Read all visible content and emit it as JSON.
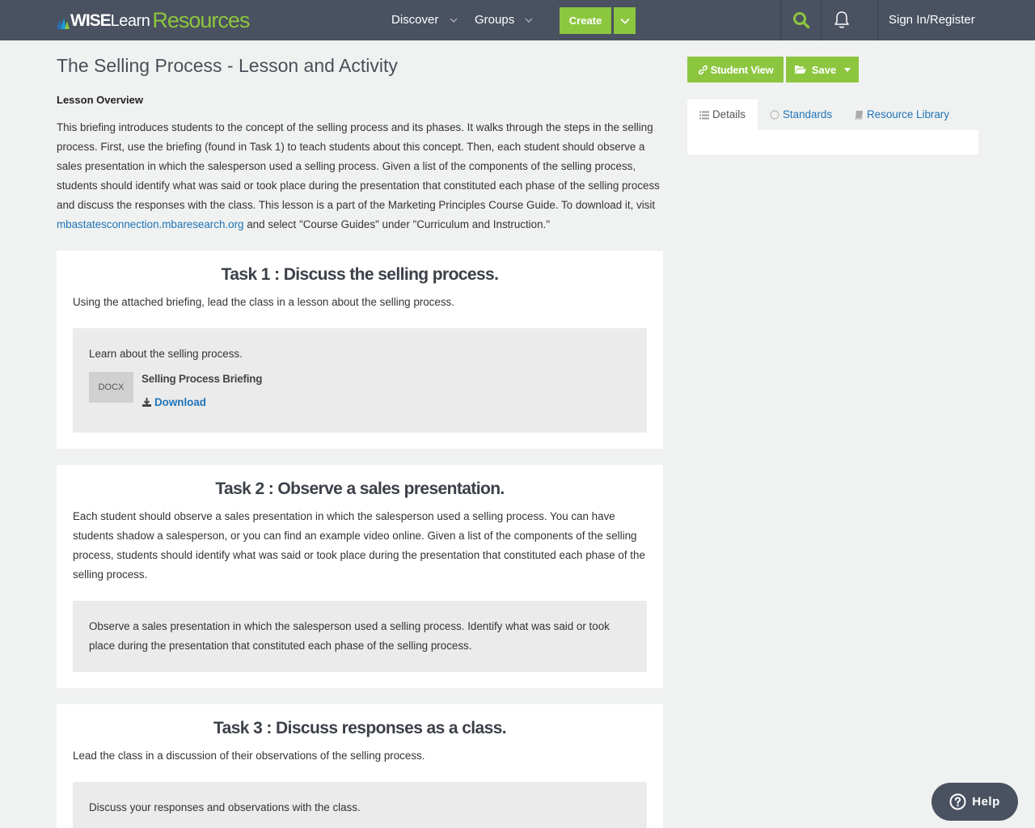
{
  "header": {
    "logo": {
      "part1": "WISE",
      "part2": "Learn",
      "part3": "Resources"
    },
    "nav": [
      {
        "label": "Discover",
        "icon": "chevron-down-icon"
      },
      {
        "label": "Groups",
        "icon": "chevron-down-icon"
      }
    ],
    "create_label": "Create",
    "search_icon": "search-icon",
    "notifications_icon": "bell-icon",
    "signin_label": "Sign In/Register"
  },
  "lesson": {
    "title": "The Selling Process - Lesson and Activity",
    "overview_heading": "Lesson Overview",
    "overview_text": "This briefing introduces students to the concept of the selling process and its phases. It walks through the steps in the selling process. First, use the briefing (found in Task 1) to teach students about this concept. Then, each student should observe a sales presentation in which the salesperson used a selling process. Given a list of the components of the selling process, students should identify what was said or took place during the presentation that constituted each phase of the selling process and discuss the responses with the class. This lesson is a part of the Marketing Principles Course Guide. To download it, visit",
    "overview_link": "mbastatesconnection.mbaresearch.org",
    "overview_tail": "and select \"Course Guides\" under \"Curriculum and Instruction.\""
  },
  "tasks": [
    {
      "title": "Task 1 : Discuss the selling process.",
      "description": "Using the attached briefing, lead the class in a lesson about the selling process.",
      "instruction": "Learn about the selling process.",
      "attachment": {
        "type": "DOCX",
        "name": "Selling Process Briefing",
        "download_label": "Download"
      }
    },
    {
      "title": "Task 2 : Observe a sales presentation.",
      "description": "Each student should observe a sales presentation in which the salesperson used a selling process. You can have students shadow a salesperson, or you can find an example video online. Given a list of the components of the selling process, students should identify what was said or took place during the presentation that constituted each phase of the selling process.",
      "instruction": "Observe a sales presentation in which the salesperson used a selling process. Identify what was said or took place during the presentation that constituted each phase of the selling process."
    },
    {
      "title": "Task 3 : Discuss responses as a class.",
      "description": "Lead the class in a discussion of their observations of the selling process.",
      "instruction": "Discuss your responses and observations with the class."
    }
  ],
  "sidebar": {
    "student_view_label": "Student View",
    "save_label": "Save",
    "tabs": [
      {
        "label": "Details",
        "icon": "list-icon",
        "active": true
      },
      {
        "label": "Standards",
        "icon": "circle-icon",
        "active": false
      },
      {
        "label": "Resource Library",
        "icon": "book-icon",
        "active": false
      }
    ]
  },
  "help_label": "Help",
  "colors": {
    "nav_bg": "#4a5160",
    "accent_green": "#8cc63f",
    "link_blue": "#1f73b7",
    "page_bg": "#f0f2f1"
  }
}
